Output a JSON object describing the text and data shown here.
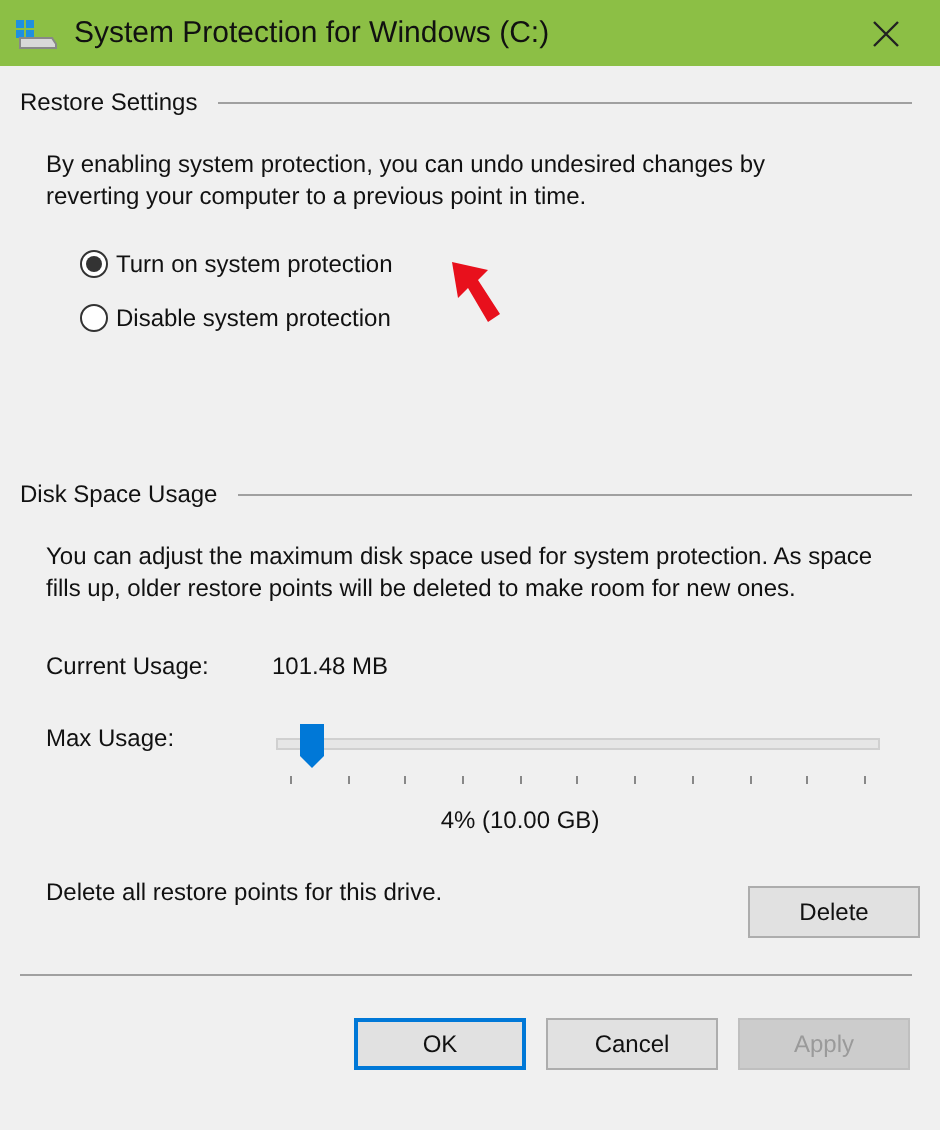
{
  "window": {
    "title": "System Protection for Windows (C:)"
  },
  "restore_settings": {
    "heading": "Restore Settings",
    "description": "By enabling system protection, you can undo undesired changes by reverting your computer to a previous point in time.",
    "options": [
      {
        "label": "Turn on system protection",
        "selected": true
      },
      {
        "label": "Disable system protection",
        "selected": false
      }
    ]
  },
  "disk_space_usage": {
    "heading": "Disk Space Usage",
    "description": "You can adjust the maximum disk space used for system protection. As space fills up, older restore points will be deleted to make room for new ones.",
    "current_usage_label": "Current Usage:",
    "current_usage_value": "101.48 MB",
    "max_usage_label": "Max Usage:",
    "max_usage": {
      "level": 0.04
    },
    "max_usage_reading": "4% (10.00 GB)",
    "delete_text": "Delete all restore points for this drive.",
    "delete_button": "Delete"
  },
  "buttons": [
    {
      "label": "OK",
      "default": true,
      "disabled": false
    },
    {
      "label": "Cancel",
      "default": false,
      "disabled": false
    },
    {
      "label": "Apply",
      "default": false,
      "disabled": true
    }
  ]
}
